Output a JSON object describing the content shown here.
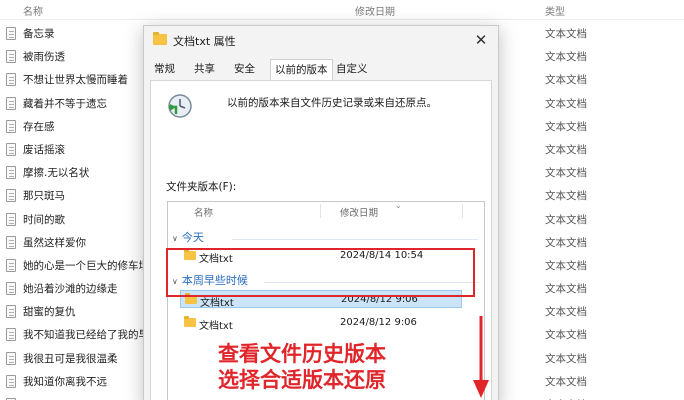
{
  "explorer": {
    "columns": {
      "name": "名称",
      "modified": "修改日期",
      "type": "类型"
    },
    "files": [
      {
        "name": "备忘录",
        "type": "文本文档"
      },
      {
        "name": "被雨伤透",
        "type": "文本文档"
      },
      {
        "name": "不想让世界太慢而睡着",
        "type": "文本文档"
      },
      {
        "name": "藏着并不等于遗忘",
        "type": "文本文档"
      },
      {
        "name": "存在感",
        "type": "文本文档"
      },
      {
        "name": "废话摇滚",
        "type": "文本文档"
      },
      {
        "name": "摩擦.无以名状",
        "type": "文本文档"
      },
      {
        "name": "那只斑马",
        "type": "文本文档"
      },
      {
        "name": "时间的歌",
        "type": "文本文档"
      },
      {
        "name": "虽然这样爱你",
        "type": "文本文档"
      },
      {
        "name": "她的心是一个巨大的修车场",
        "type": "文本文档"
      },
      {
        "name": "她沿着沙滩的边缘走",
        "type": "文本文档"
      },
      {
        "name": "甜蜜的复仇",
        "type": "文本文档"
      },
      {
        "name": "我不知道我已经给了我的早...",
        "type": "文本文档"
      },
      {
        "name": "我很丑可是我很温柔",
        "type": "文本文档"
      },
      {
        "name": "我知道你离我不远",
        "type": "文本文档"
      },
      {
        "name": "",
        "type": "文本文档"
      }
    ]
  },
  "dialog": {
    "title": "文档txt 属性",
    "close_glyph": "✕",
    "tabs": [
      "常规",
      "共享",
      "安全",
      "以前的版本",
      "自定义"
    ],
    "active_tab": "以前的版本",
    "description": "以前的版本来自文件历史记录或来自还原点。",
    "folder_versions_label": "文件夹版本(F):",
    "list_columns": {
      "name": "名称",
      "modified": "修改日期"
    },
    "groups": [
      {
        "label": "今天",
        "items": [
          {
            "name": "文档txt",
            "date": "2024/8/14 10:54",
            "selected": false
          }
        ]
      },
      {
        "label": "本周早些时候",
        "items": [
          {
            "name": "文档txt",
            "date": "2024/8/12 9:06",
            "selected": true
          },
          {
            "name": "文档txt",
            "date": "2024/8/12 9:06",
            "selected": false
          }
        ]
      }
    ]
  },
  "annotation": {
    "line1": "查看文件历史版本",
    "line2": "选择合适版本还原",
    "color": "#e0262b"
  },
  "colors": {
    "folder": "#f6c344",
    "group_text": "#2a6cc0",
    "selection": "#cce4f7"
  }
}
